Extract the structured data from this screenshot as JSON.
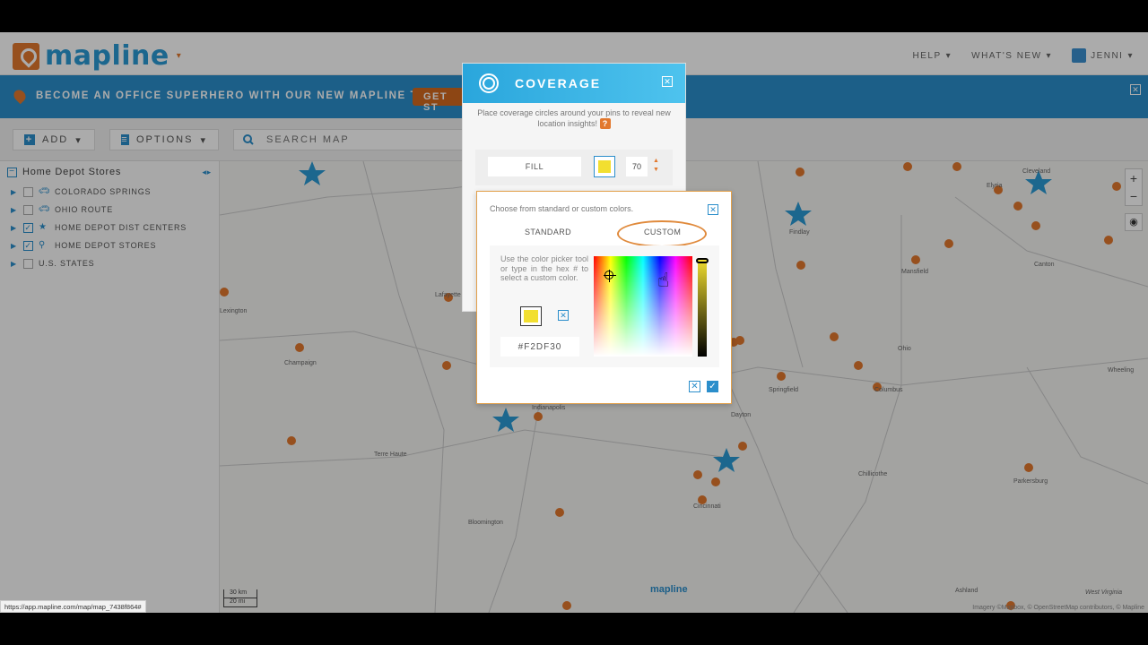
{
  "header": {
    "logo_text": "mapline",
    "nav": [
      "HELP",
      "WHAT'S NEW",
      "JENNI"
    ]
  },
  "banner": {
    "text": "BECOME AN OFFICE SUPERHERO WITH OUR NEW MAPLINE TRAINING!",
    "button": "GET ST"
  },
  "toolbar": {
    "add_label": "ADD",
    "options_label": "OPTIONS",
    "search_placeholder": "SEARCH MAP"
  },
  "sidebar": {
    "title": "Home Depot Stores",
    "layers": [
      {
        "label": "COLORADO SPRINGS",
        "checked": false,
        "icon": "car-icon"
      },
      {
        "label": "OHIO ROUTE",
        "checked": false,
        "icon": "car-icon"
      },
      {
        "label": "HOME DEPOT DIST CENTERS",
        "checked": true,
        "icon": "star-icon"
      },
      {
        "label": "HOME DEPOT STORES",
        "checked": true,
        "icon": "pin-icon"
      },
      {
        "label": "U.S. STATES",
        "checked": false,
        "icon": ""
      }
    ]
  },
  "map": {
    "cities": [
      "Cleveland",
      "Elyria",
      "Findlay",
      "Mansfield",
      "Canton",
      "Wheeling",
      "Ohio",
      "Columbus",
      "Springfield",
      "Dayton",
      "Lafayette",
      "Champaign",
      "Terre Haute",
      "Bloomington",
      "Indianapolis",
      "Chillicothe",
      "Parkersburg",
      "Cincinnati",
      "Ashland",
      "West Virginia",
      "Lexington"
    ],
    "scale_km": "30 km",
    "scale_mi": "20 mi",
    "watermark": "mapline",
    "attribution": "Imagery ©Mapbox, © OpenStreetMap contributors, © Mapline"
  },
  "coverage": {
    "title": "COVERAGE",
    "description": "Place coverage circles around your pins to reveal new location insights!",
    "help": "?",
    "fill_label": "FILL",
    "fill_value": "70",
    "fill_color": "#F2DF30"
  },
  "color_popup": {
    "description": "Choose from standard or custom colors.",
    "tab_standard": "STANDARD",
    "tab_custom": "CUSTOM",
    "help_text": "Use the color picker tool or type in the hex # to select a custom color.",
    "hex_value": "#F2DF30"
  },
  "status_url": "https://app.mapline.com/map/map_7438f864#",
  "colors": {
    "accent": "#2b8ecb",
    "brand_orange": "#e2782e",
    "selected": "#F2DF30"
  }
}
